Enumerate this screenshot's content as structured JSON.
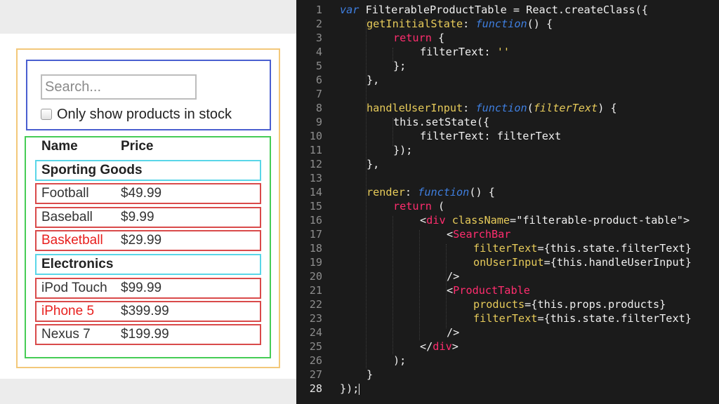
{
  "mockup": {
    "search": {
      "placeholder": "Search..."
    },
    "stock_label": "Only show products in stock",
    "headers": {
      "name": "Name",
      "price": "Price"
    },
    "rows": [
      {
        "type": "category",
        "name": "Sporting Goods"
      },
      {
        "type": "product",
        "name": "Football",
        "price": "$49.99",
        "stocked": true
      },
      {
        "type": "product",
        "name": "Baseball",
        "price": "$9.99",
        "stocked": true
      },
      {
        "type": "product",
        "name": "Basketball",
        "price": "$29.99",
        "stocked": false
      },
      {
        "type": "category",
        "name": "Electronics"
      },
      {
        "type": "product",
        "name": "iPod Touch",
        "price": "$99.99",
        "stocked": true
      },
      {
        "type": "product",
        "name": "iPhone 5",
        "price": "$399.99",
        "stocked": false
      },
      {
        "type": "product",
        "name": "Nexus 7",
        "price": "$199.99",
        "stocked": true
      }
    ],
    "colors": {
      "filterable_product_table": "#f3c87a",
      "search_bar": "#4a5fd0",
      "product_table": "#45cc55",
      "category_row": "#5ad6e8",
      "product_row": "#d94a4a",
      "out_of_stock_text": "#e8201e"
    }
  },
  "editor": {
    "line_numbers": [
      "1",
      "2",
      "3",
      "4",
      "5",
      "6",
      "7",
      "8",
      "9",
      "10",
      "11",
      "12",
      "13",
      "14",
      "15",
      "16",
      "17",
      "18",
      "19",
      "20",
      "21",
      "22",
      "23",
      "24",
      "25",
      "26",
      "27",
      "28"
    ],
    "current_line": "28",
    "code": {
      "l1": {
        "kw": "var",
        "rest": " FilterableProductTable = React.createClass({"
      },
      "l2": {
        "fn": "getInitialState",
        "sep": ": ",
        "kw": "function",
        "rest": "() {"
      },
      "l3": {
        "kw": "return",
        "rest": " {"
      },
      "l4": {
        "key": "filterText: ",
        "str": "''"
      },
      "l5": {
        "text": "};"
      },
      "l6": {
        "text": "},"
      },
      "l8": {
        "fn": "handleUserInput",
        "sep": ": ",
        "kw": "function",
        "open": "(",
        "param": "filterText",
        "rest": ") {"
      },
      "l9": {
        "text": "this.setState({"
      },
      "l10": {
        "text": "filterText: filterText"
      },
      "l11": {
        "text": "});"
      },
      "l12": {
        "text": "},"
      },
      "l14": {
        "fn": "render",
        "sep": ": ",
        "kw": "function",
        "rest": "() {"
      },
      "l15": {
        "kw": "return",
        "rest": " ("
      },
      "l16": {
        "lt": "<",
        "tag": "div",
        "sp": " ",
        "attr": "className",
        "eq": "=",
        "str": "\"filterable-product-table\"",
        "gt": ">"
      },
      "l17": {
        "lt": "<",
        "tag": "SearchBar"
      },
      "l18": {
        "attr": "filterText",
        "rest": "={this.state.filterText}"
      },
      "l19": {
        "attr": "onUserInput",
        "rest": "={this.handleUserInput}"
      },
      "l20": {
        "text": "/>"
      },
      "l21": {
        "lt": "<",
        "tag": "ProductTable"
      },
      "l22": {
        "attr": "products",
        "rest": "={this.props.products}"
      },
      "l23": {
        "attr": "filterText",
        "rest": "={this.state.filterText}"
      },
      "l24": {
        "text": "/>"
      },
      "l25": {
        "lt": "</",
        "tag": "div",
        "gt": ">"
      },
      "l26": {
        "text": ");"
      },
      "l27": {
        "text": "}"
      },
      "l28": {
        "text": "});"
      }
    },
    "colors": {
      "background": "#1b1b1b",
      "keyword": "#3f7fe0",
      "function_name": "#e7cb5a",
      "tag": "#ff2d6e",
      "string": "#e7cb5a"
    }
  }
}
